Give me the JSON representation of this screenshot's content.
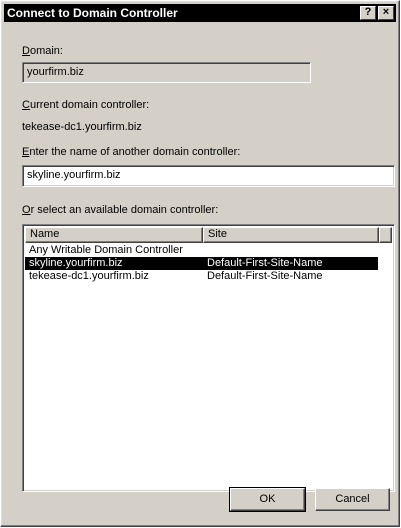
{
  "window": {
    "title": "Connect to Domain Controller",
    "help_label": "?",
    "close_label": "×"
  },
  "domain": {
    "label_accel": "D",
    "label_rest": "omain:",
    "value": "yourfirm.biz"
  },
  "current_dc": {
    "label_accel": "C",
    "label_rest": "urrent domain controller:",
    "value": "tekease-dc1.yourfirm.biz"
  },
  "enter_dc": {
    "label_accel": "E",
    "label_rest": "nter the name of another domain controller:",
    "value": "skyline.yourfirm.biz"
  },
  "available_dc": {
    "label_accel": "O",
    "label_rest": "r select an available domain controller:",
    "columns": [
      "Name",
      "Site"
    ],
    "rows": [
      {
        "name": "Any Writable Domain Controller",
        "site": "",
        "selected": false
      },
      {
        "name": "skyline.yourfirm.biz",
        "site": "Default-First-Site-Name",
        "selected": true
      },
      {
        "name": "tekease-dc1.yourfirm.biz",
        "site": "Default-First-Site-Name",
        "selected": false
      }
    ]
  },
  "buttons": {
    "ok": "OK",
    "cancel": "Cancel"
  },
  "colors": {
    "dialog_face": "#d4d0c8",
    "title_bar": "#000000",
    "selection": "#000000"
  }
}
